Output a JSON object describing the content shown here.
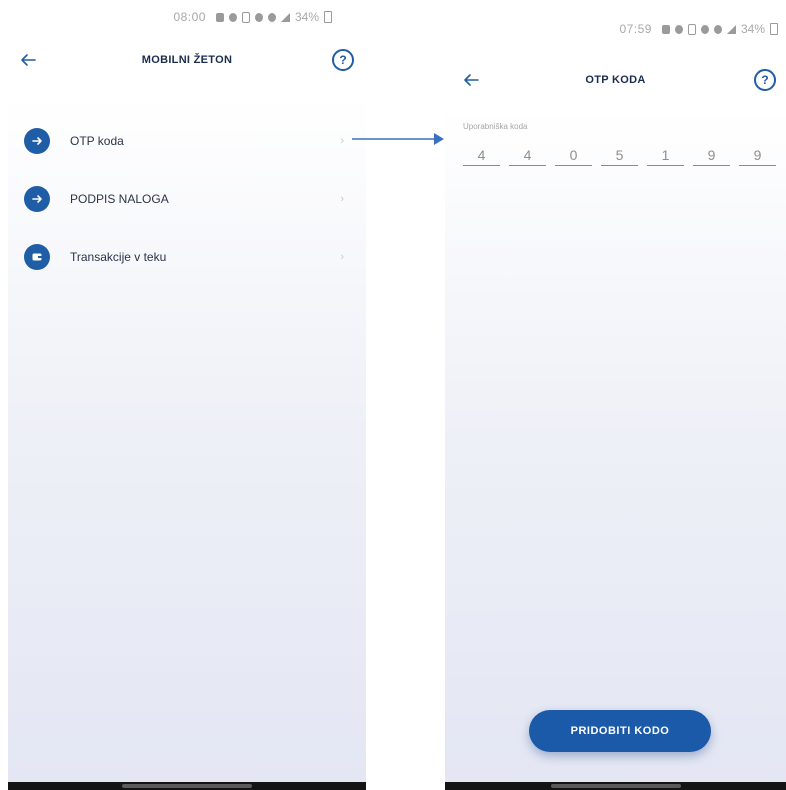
{
  "left_screen": {
    "status_time": "08:00",
    "status_battery": "34%",
    "title": "MOBILNI ŽETON",
    "help_label": "?",
    "menu_items": [
      {
        "label": "OTP koda",
        "icon": "arrow-right-icon"
      },
      {
        "label": "PODPIS NALOGA",
        "icon": "arrow-right-icon"
      },
      {
        "label": "Transakcije v teku",
        "icon": "wallet-icon"
      }
    ]
  },
  "right_screen": {
    "status_time": "07:59",
    "status_battery": "34%",
    "title": "OTP KODA",
    "help_label": "?",
    "code_label": "Uporabniška koda",
    "code_digits": [
      "4",
      "4",
      "0",
      "5",
      "1",
      "9",
      "9"
    ],
    "primary_button": "PRIDOBITI KODO"
  },
  "colors": {
    "accent": "#1f5da6",
    "button": "#1a5aa8",
    "title_text": "#1b2c4f"
  }
}
